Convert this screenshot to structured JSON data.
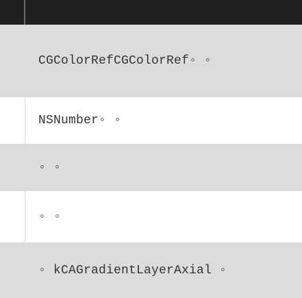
{
  "rows": [
    {
      "text": "CGColorRefCGColorRef◦ ◦"
    },
    {
      "text": "NSNumber◦ ◦"
    },
    {
      "text": "◦ ◦"
    },
    {
      "text": "◦ ◦"
    },
    {
      "text": "◦ kCAGradientLayerAxial ◦"
    }
  ]
}
